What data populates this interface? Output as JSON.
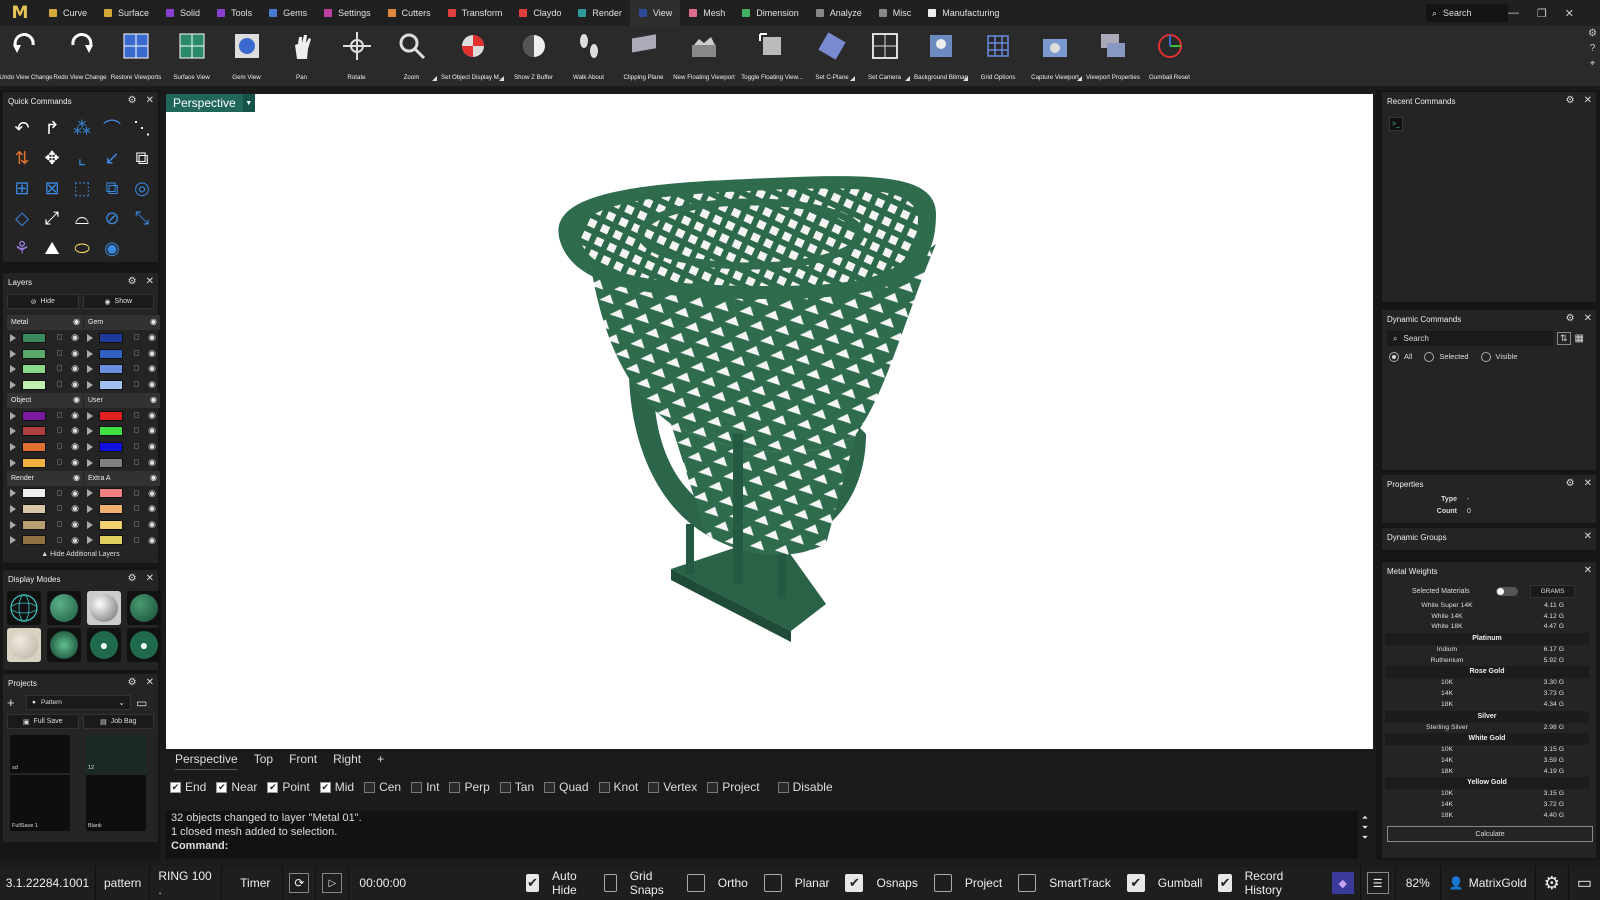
{
  "app": {
    "logo": "M"
  },
  "menu": [
    {
      "label": "Curve",
      "color": "#d4a93a"
    },
    {
      "label": "Surface",
      "color": "#d4a93a"
    },
    {
      "label": "Solid",
      "color": "#8a3fd0"
    },
    {
      "label": "Tools",
      "color": "#8a3fd0"
    },
    {
      "label": "Gems",
      "color": "#4a7ad0"
    },
    {
      "label": "Settings",
      "color": "#c040a0"
    },
    {
      "label": "Cutters",
      "color": "#e08a40"
    },
    {
      "label": "Transform",
      "color": "#e04040"
    },
    {
      "label": "Claydo",
      "color": "#e04040"
    },
    {
      "label": "Render",
      "color": "#2f9a9a"
    },
    {
      "label": "View",
      "color": "#2a4a9a"
    },
    {
      "label": "Mesh",
      "color": "#e06a8a"
    },
    {
      "label": "Dimension",
      "color": "#40b060"
    },
    {
      "label": "Analyze",
      "color": "#888888"
    },
    {
      "label": "Misc",
      "color": "#888888"
    },
    {
      "label": "Manufacturing",
      "color": "#eeeeee"
    }
  ],
  "menu_active": "View",
  "top_search": {
    "label": "Search"
  },
  "window_buttons": [
    "—",
    "❐",
    "✕"
  ],
  "toolbar": [
    {
      "label": "Undo View Change"
    },
    {
      "label": "Redo View Change"
    },
    {
      "label": "Restore Viewports"
    },
    {
      "label": "Surface View"
    },
    {
      "label": "Gem View"
    },
    {
      "label": "Pan"
    },
    {
      "label": "Rotate"
    },
    {
      "label": "Zoom"
    },
    {
      "label": "Set Object Display M..."
    },
    {
      "label": "Show Z Buffer"
    },
    {
      "label": "Walk About"
    },
    {
      "label": "Clipping Plane"
    },
    {
      "label": "New Floating Viewport"
    },
    {
      "label": "Toggle Floating View..."
    },
    {
      "label": "Set C-Plane"
    },
    {
      "label": "Set Camera"
    },
    {
      "label": "Background Bitmap"
    },
    {
      "label": "Grid Options"
    },
    {
      "label": "Capture Viewport"
    },
    {
      "label": "Viewport Properties"
    },
    {
      "label": "Gumball Reset"
    }
  ],
  "quick_commands": {
    "title": "Quick Commands"
  },
  "layers": {
    "title": "Layers",
    "hide": "Hide",
    "show": "Show",
    "groups": [
      {
        "name": "Metal",
        "colors": [
          "#3a8a5a",
          "#5aa86a",
          "#8ad88a",
          "#c0f0b0"
        ]
      },
      {
        "name": "Gem",
        "colors": [
          "#1e3a9a",
          "#3060c0",
          "#6a90e0",
          "#a0c0f0"
        ]
      },
      {
        "name": "Object",
        "colors": [
          "#7a1aa0",
          "#b04040",
          "#e07030",
          "#f0b040"
        ]
      },
      {
        "name": "User",
        "colors": [
          "#e02020",
          "#40e040",
          "#1010e0",
          "#808080"
        ]
      },
      {
        "name": "Render",
        "colors": [
          "#f0f0f0",
          "#d8c8a8",
          "#b8a070",
          "#907040"
        ]
      },
      {
        "name": "Extra A",
        "colors": [
          "#f08080",
          "#f0b070",
          "#f0d070",
          "#e0d060"
        ]
      }
    ],
    "hide_additional": "Hide Additional Layers"
  },
  "display_modes": {
    "title": "Display Modes"
  },
  "projects": {
    "title": "Projects",
    "selected": "Pattern",
    "full_save": "Full Save",
    "job_bag": "Job Bag",
    "thumbs": [
      "sd",
      "12",
      "FullSave 1",
      "Blank"
    ]
  },
  "viewport": {
    "active_tab": "Perspective",
    "tabs": [
      "Perspective",
      "Top",
      "Front",
      "Right",
      "+"
    ]
  },
  "osnaps": [
    {
      "label": "End",
      "on": true
    },
    {
      "label": "Near",
      "on": true
    },
    {
      "label": "Point",
      "on": true
    },
    {
      "label": "Mid",
      "on": true
    },
    {
      "label": "Cen",
      "on": false
    },
    {
      "label": "Int",
      "on": false
    },
    {
      "label": "Perp",
      "on": false
    },
    {
      "label": "Tan",
      "on": false
    },
    {
      "label": "Quad",
      "on": false
    },
    {
      "label": "Knot",
      "on": false
    },
    {
      "label": "Vertex",
      "on": false
    },
    {
      "label": "Project",
      "on": false
    },
    {
      "label": "Disable",
      "on": false
    }
  ],
  "command": {
    "history": [
      "32 objects changed to layer \"Metal 01\".",
      "1 closed mesh added to selection."
    ],
    "prompt": "Command:"
  },
  "status": {
    "version": "3.1.22284.1001",
    "project": "pattern",
    "file": "RING 100 .",
    "timer": "Timer",
    "time": "00:00:00",
    "toggles": [
      {
        "label": "Auto Hide",
        "on": true
      },
      {
        "label": "Grid Snaps",
        "on": false
      },
      {
        "label": "Ortho",
        "on": false
      },
      {
        "label": "Planar",
        "on": false
      },
      {
        "label": "Osnaps",
        "on": true
      },
      {
        "label": "Project",
        "on": false
      },
      {
        "label": "SmartTrack",
        "on": false
      },
      {
        "label": "Gumball",
        "on": true
      },
      {
        "label": "Record History",
        "on": true
      }
    ],
    "zoom": "82%",
    "user": "MatrixGold"
  },
  "recent_commands": {
    "title": "Recent Commands"
  },
  "dynamic_commands": {
    "title": "Dynamic Commands",
    "search": "Search",
    "filters": [
      {
        "label": "All",
        "on": true
      },
      {
        "label": "Selected",
        "on": false
      },
      {
        "label": "Visible",
        "on": false
      }
    ]
  },
  "properties": {
    "title": "Properties",
    "type_label": "Type",
    "type_value": "-",
    "count_label": "Count",
    "count_value": "0"
  },
  "dynamic_groups": {
    "title": "Dynamic Groups"
  },
  "metal_weights": {
    "title": "Metal Weights",
    "selected_materials": "Selected Materials",
    "unit": "GRAMS",
    "rows": [
      {
        "type": "row",
        "name": "White Super 14K",
        "value": "4.11 G"
      },
      {
        "type": "row",
        "name": "White 14K",
        "value": "4.12 G"
      },
      {
        "type": "row",
        "name": "White 18K",
        "value": "4.47 G"
      },
      {
        "type": "group",
        "name": "Platinum"
      },
      {
        "type": "row",
        "name": "Iridium",
        "value": "6.17 G"
      },
      {
        "type": "row",
        "name": "Ruthenium",
        "value": "5.92 G"
      },
      {
        "type": "group",
        "name": "Rose Gold"
      },
      {
        "type": "row",
        "name": "10K",
        "value": "3.30 G"
      },
      {
        "type": "row",
        "name": "14K",
        "value": "3.73 G"
      },
      {
        "type": "row",
        "name": "18K",
        "value": "4.34 G"
      },
      {
        "type": "group",
        "name": "Silver"
      },
      {
        "type": "row",
        "name": "Sterling Silver",
        "value": "2.98 G"
      },
      {
        "type": "group",
        "name": "White Gold"
      },
      {
        "type": "row",
        "name": "10K",
        "value": "3.15 G"
      },
      {
        "type": "row",
        "name": "14K",
        "value": "3.59 G"
      },
      {
        "type": "row",
        "name": "18K",
        "value": "4.19 G"
      },
      {
        "type": "group",
        "name": "Yellow Gold"
      },
      {
        "type": "row",
        "name": "10K",
        "value": "3.15 G"
      },
      {
        "type": "row",
        "name": "14K",
        "value": "3.72 G"
      },
      {
        "type": "row",
        "name": "18K",
        "value": "4.40 G"
      }
    ],
    "calculate": "Calculate"
  },
  "colors": {
    "accent": "#20665a",
    "ring": "#2f6a4c"
  }
}
